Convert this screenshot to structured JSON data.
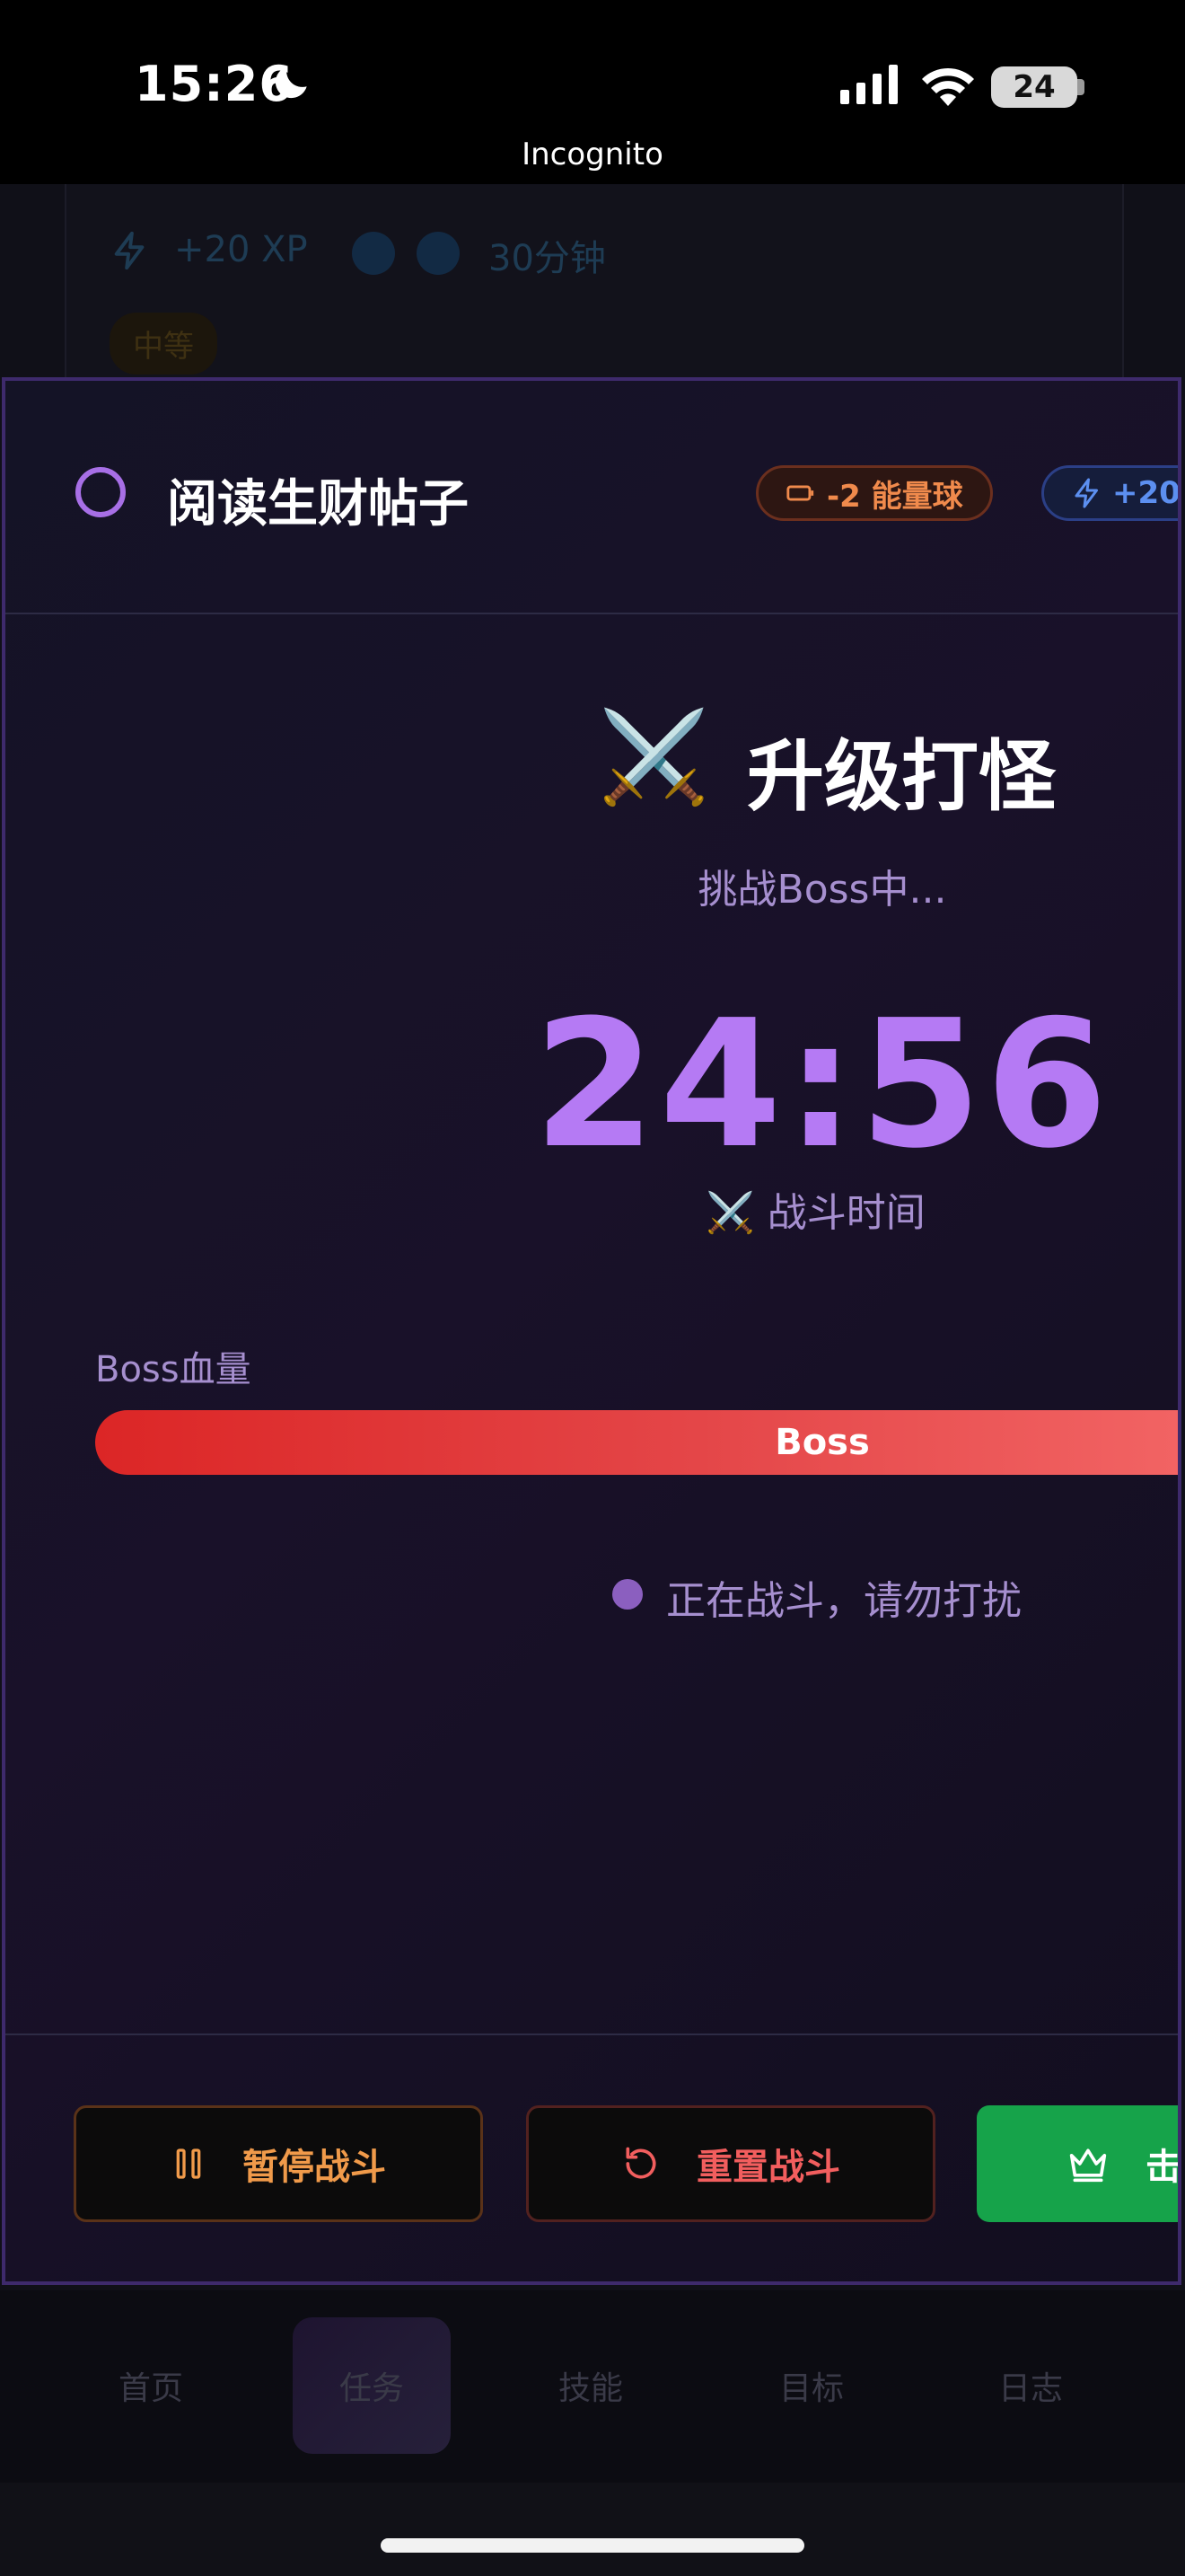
{
  "status_bar": {
    "time": "15:26",
    "battery": "24",
    "incognito_label": "Incognito"
  },
  "background_card": {
    "xp": "+20 XP",
    "duration": "30分钟",
    "difficulty": "中等"
  },
  "modal": {
    "task_title": "阅读生财帖子",
    "energy_chip": "-2 能量球",
    "xp_chip": "+20",
    "battle_icon": "⚔️",
    "battle_title": "升级打怪",
    "battle_subtitle": "挑战Boss中...",
    "timer": "24:56",
    "timer_label": "⚔️ 战斗时间",
    "hp_label": "Boss血量",
    "hp_bar_text": "Boss",
    "hp_fraction": 1.0,
    "status_text": "正在战斗，请勿打扰",
    "buttons": {
      "pause": "暂停战斗",
      "reset": "重置战斗",
      "kill": "击"
    }
  },
  "bottom_nav": {
    "items": [
      "首页",
      "任务",
      "技能",
      "目标",
      "日志"
    ],
    "active": "任务"
  },
  "colors": {
    "accent": "#b57af4",
    "hp": "#dc2626",
    "energy": "#f08a4c",
    "xp": "#5c8ff0",
    "success": "#16a34a"
  }
}
